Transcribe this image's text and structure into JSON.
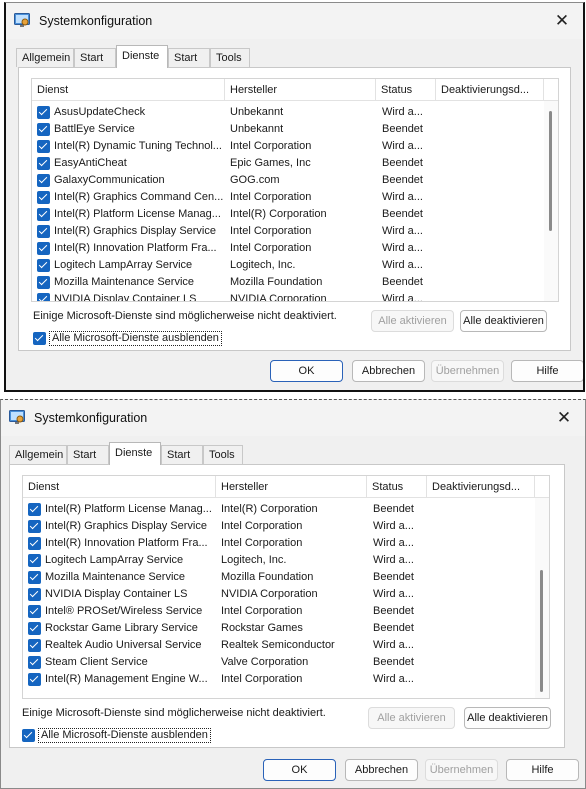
{
  "title": "Systemkonfiguration",
  "tabs": [
    "Allgemein",
    "Start",
    "Dienste",
    "Start",
    "Tools"
  ],
  "columns": {
    "service": "Dienst",
    "manufacturer": "Hersteller",
    "status": "Status",
    "disabled_date": "Deaktivierungsd..."
  },
  "note": "Einige Microsoft-Dienste sind möglicherweise nicht deaktiviert.",
  "buttons": {
    "enable_all": "Alle aktivieren",
    "disable_all": "Alle deaktivieren",
    "ok": "OK",
    "cancel": "Abbrechen",
    "apply": "Übernehmen",
    "help": "Hilfe"
  },
  "hide_microsoft_label": "Alle Microsoft-Dienste ausblenden",
  "window1_rows": [
    {
      "service": "AsusUpdateCheck",
      "manufacturer": "Unbekannt",
      "status": "Wird a..."
    },
    {
      "service": "BattlEye Service",
      "manufacturer": "Unbekannt",
      "status": "Beendet"
    },
    {
      "service": "Intel(R) Dynamic Tuning Technol...",
      "manufacturer": "Intel Corporation",
      "status": "Wird a..."
    },
    {
      "service": "EasyAntiCheat",
      "manufacturer": "Epic Games, Inc",
      "status": "Beendet"
    },
    {
      "service": "GalaxyCommunication",
      "manufacturer": "GOG.com",
      "status": "Beendet"
    },
    {
      "service": "Intel(R) Graphics Command Cen...",
      "manufacturer": "Intel Corporation",
      "status": "Wird a..."
    },
    {
      "service": "Intel(R) Platform License Manag...",
      "manufacturer": "Intel(R) Corporation",
      "status": "Beendet"
    },
    {
      "service": "Intel(R) Graphics Display Service",
      "manufacturer": "Intel Corporation",
      "status": "Wird a..."
    },
    {
      "service": "Intel(R) Innovation Platform Fra...",
      "manufacturer": "Intel Corporation",
      "status": "Wird a..."
    },
    {
      "service": "Logitech LampArray Service",
      "manufacturer": "Logitech, Inc.",
      "status": "Wird a..."
    },
    {
      "service": "Mozilla Maintenance Service",
      "manufacturer": "Mozilla Foundation",
      "status": "Beendet"
    },
    {
      "service": "NVIDIA Display Container LS",
      "manufacturer": "NVIDIA Corporation",
      "status": "Wird a..."
    }
  ],
  "window2_rows": [
    {
      "service": "Intel(R) Platform License Manag...",
      "manufacturer": "Intel(R) Corporation",
      "status": "Beendet"
    },
    {
      "service": "Intel(R) Graphics Display Service",
      "manufacturer": "Intel Corporation",
      "status": "Wird a..."
    },
    {
      "service": "Intel(R) Innovation Platform Fra...",
      "manufacturer": "Intel Corporation",
      "status": "Wird a..."
    },
    {
      "service": "Logitech LampArray Service",
      "manufacturer": "Logitech, Inc.",
      "status": "Wird a..."
    },
    {
      "service": "Mozilla Maintenance Service",
      "manufacturer": "Mozilla Foundation",
      "status": "Beendet"
    },
    {
      "service": "NVIDIA Display Container LS",
      "manufacturer": "NVIDIA Corporation",
      "status": "Wird a..."
    },
    {
      "service": "Intel® PROSet/Wireless Service",
      "manufacturer": "Intel Corporation",
      "status": "Beendet"
    },
    {
      "service": "Rockstar Game Library Service",
      "manufacturer": "Rockstar Games",
      "status": "Beendet"
    },
    {
      "service": "Realtek Audio Universal Service",
      "manufacturer": "Realtek Semiconductor",
      "status": "Wird a..."
    },
    {
      "service": "Steam Client Service",
      "manufacturer": "Valve Corporation",
      "status": "Beendet"
    },
    {
      "service": "Intel(R) Management Engine W...",
      "manufacturer": "Intel Corporation",
      "status": "Wird a..."
    }
  ]
}
